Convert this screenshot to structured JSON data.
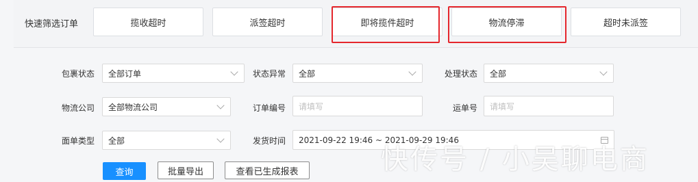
{
  "quick_filter": {
    "label": "快速筛选订单",
    "buttons": [
      "揽收超时",
      "派签超时",
      "即将揽件超时",
      "物流停滞",
      "超时未派签"
    ]
  },
  "accent_highlight_color": "#e5262c",
  "form": {
    "package_status": {
      "label": "包裹状态",
      "value": "全部订单"
    },
    "status_exception": {
      "label": "状态异常",
      "value": "全部"
    },
    "process_status": {
      "label": "处理状态",
      "value": "全部"
    },
    "logistics_company": {
      "label": "物流公司",
      "value": "全部物流公司"
    },
    "order_number": {
      "label": "订单编号",
      "placeholder": "请填写"
    },
    "tracking_number": {
      "label": "运单号",
      "placeholder": "请填写"
    },
    "waybill_type": {
      "label": "面单类型",
      "value": "全部"
    },
    "ship_time": {
      "label": "发货时间",
      "value": "2021-09-22 19:46 ~ 2021-09-29 19:46"
    }
  },
  "actions": {
    "query": "查询",
    "bulk_export": "批量导出",
    "view_reports": "查看已生成报表"
  },
  "watermark": "快传号 / 小吴聊电商"
}
